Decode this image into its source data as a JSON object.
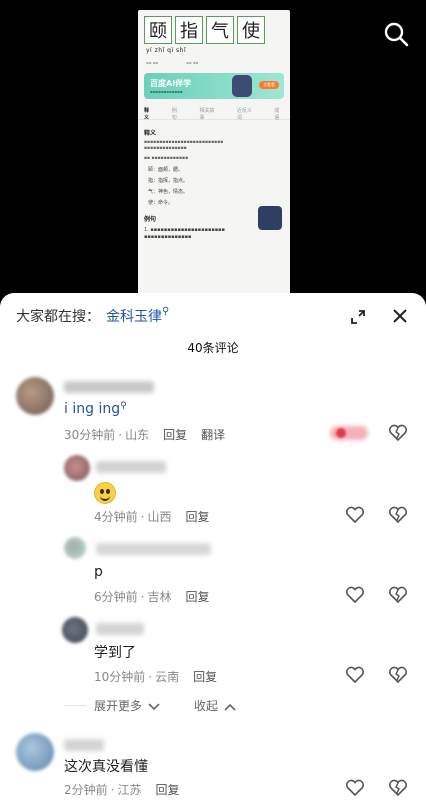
{
  "video": {
    "idiom_chars": [
      "颐",
      "指",
      "气",
      "使"
    ],
    "pinyin": "yí zhǐ qì shǐ",
    "ai_banner": {
      "title": "百度AI伴学",
      "button": "去看看"
    },
    "tabs": [
      "释义",
      "例句",
      "相关故事",
      "近反义词",
      "成语"
    ],
    "section_meaning": "释义",
    "list_items": [
      "颐：面颊，腮。",
      "指：指挥，指点。",
      "气：神色，情态。",
      "使：命令。"
    ],
    "section_example": "例句"
  },
  "sheet": {
    "search_prefix": "大家都在搜：",
    "search_keyword": "金科玉律",
    "comment_count": "40条评论",
    "comments": [
      {
        "text_keyword": "i ing ing",
        "time": "30分钟前",
        "location": "山东",
        "reply": "回复",
        "translate": "翻译"
      },
      {
        "emoji": "grinning-emoji",
        "time": "4分钟前",
        "location": "山西",
        "reply": "回复"
      },
      {
        "text": "p",
        "time": "6分钟前",
        "location": "吉林",
        "reply": "回复"
      },
      {
        "text": "学到了",
        "time": "10分钟前",
        "location": "云南",
        "reply": "回复"
      },
      {
        "text": "这次真没看懂",
        "time": "2分钟前",
        "location": "江苏",
        "reply": "回复"
      }
    ],
    "expand_more": "展开更多",
    "collapse": "收起"
  },
  "colors": {
    "keyword": "#2255a4",
    "meta": "#888888",
    "sheet_bg": "#ffffff",
    "video_bg": "#000000"
  },
  "icons": [
    "search-icon",
    "expand-icon",
    "close-icon",
    "like-icon",
    "dislike-icon",
    "chevron-down-icon",
    "chevron-up-icon"
  ]
}
